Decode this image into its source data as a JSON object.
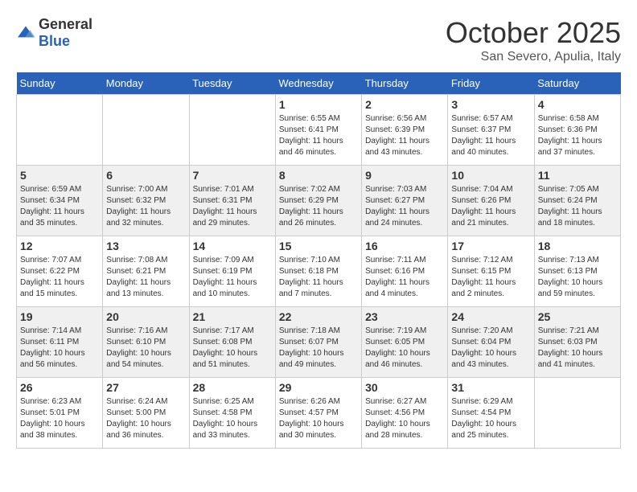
{
  "header": {
    "logo_general": "General",
    "logo_blue": "Blue",
    "month_title": "October 2025",
    "subtitle": "San Severo, Apulia, Italy"
  },
  "days_of_week": [
    "Sunday",
    "Monday",
    "Tuesday",
    "Wednesday",
    "Thursday",
    "Friday",
    "Saturday"
  ],
  "weeks": [
    {
      "days": [
        {
          "number": "",
          "info": ""
        },
        {
          "number": "",
          "info": ""
        },
        {
          "number": "",
          "info": ""
        },
        {
          "number": "1",
          "info": "Sunrise: 6:55 AM\nSunset: 6:41 PM\nDaylight: 11 hours and 46 minutes."
        },
        {
          "number": "2",
          "info": "Sunrise: 6:56 AM\nSunset: 6:39 PM\nDaylight: 11 hours and 43 minutes."
        },
        {
          "number": "3",
          "info": "Sunrise: 6:57 AM\nSunset: 6:37 PM\nDaylight: 11 hours and 40 minutes."
        },
        {
          "number": "4",
          "info": "Sunrise: 6:58 AM\nSunset: 6:36 PM\nDaylight: 11 hours and 37 minutes."
        }
      ],
      "shaded": false
    },
    {
      "days": [
        {
          "number": "5",
          "info": "Sunrise: 6:59 AM\nSunset: 6:34 PM\nDaylight: 11 hours and 35 minutes."
        },
        {
          "number": "6",
          "info": "Sunrise: 7:00 AM\nSunset: 6:32 PM\nDaylight: 11 hours and 32 minutes."
        },
        {
          "number": "7",
          "info": "Sunrise: 7:01 AM\nSunset: 6:31 PM\nDaylight: 11 hours and 29 minutes."
        },
        {
          "number": "8",
          "info": "Sunrise: 7:02 AM\nSunset: 6:29 PM\nDaylight: 11 hours and 26 minutes."
        },
        {
          "number": "9",
          "info": "Sunrise: 7:03 AM\nSunset: 6:27 PM\nDaylight: 11 hours and 24 minutes."
        },
        {
          "number": "10",
          "info": "Sunrise: 7:04 AM\nSunset: 6:26 PM\nDaylight: 11 hours and 21 minutes."
        },
        {
          "number": "11",
          "info": "Sunrise: 7:05 AM\nSunset: 6:24 PM\nDaylight: 11 hours and 18 minutes."
        }
      ],
      "shaded": true
    },
    {
      "days": [
        {
          "number": "12",
          "info": "Sunrise: 7:07 AM\nSunset: 6:22 PM\nDaylight: 11 hours and 15 minutes."
        },
        {
          "number": "13",
          "info": "Sunrise: 7:08 AM\nSunset: 6:21 PM\nDaylight: 11 hours and 13 minutes."
        },
        {
          "number": "14",
          "info": "Sunrise: 7:09 AM\nSunset: 6:19 PM\nDaylight: 11 hours and 10 minutes."
        },
        {
          "number": "15",
          "info": "Sunrise: 7:10 AM\nSunset: 6:18 PM\nDaylight: 11 hours and 7 minutes."
        },
        {
          "number": "16",
          "info": "Sunrise: 7:11 AM\nSunset: 6:16 PM\nDaylight: 11 hours and 4 minutes."
        },
        {
          "number": "17",
          "info": "Sunrise: 7:12 AM\nSunset: 6:15 PM\nDaylight: 11 hours and 2 minutes."
        },
        {
          "number": "18",
          "info": "Sunrise: 7:13 AM\nSunset: 6:13 PM\nDaylight: 10 hours and 59 minutes."
        }
      ],
      "shaded": false
    },
    {
      "days": [
        {
          "number": "19",
          "info": "Sunrise: 7:14 AM\nSunset: 6:11 PM\nDaylight: 10 hours and 56 minutes."
        },
        {
          "number": "20",
          "info": "Sunrise: 7:16 AM\nSunset: 6:10 PM\nDaylight: 10 hours and 54 minutes."
        },
        {
          "number": "21",
          "info": "Sunrise: 7:17 AM\nSunset: 6:08 PM\nDaylight: 10 hours and 51 minutes."
        },
        {
          "number": "22",
          "info": "Sunrise: 7:18 AM\nSunset: 6:07 PM\nDaylight: 10 hours and 49 minutes."
        },
        {
          "number": "23",
          "info": "Sunrise: 7:19 AM\nSunset: 6:05 PM\nDaylight: 10 hours and 46 minutes."
        },
        {
          "number": "24",
          "info": "Sunrise: 7:20 AM\nSunset: 6:04 PM\nDaylight: 10 hours and 43 minutes."
        },
        {
          "number": "25",
          "info": "Sunrise: 7:21 AM\nSunset: 6:03 PM\nDaylight: 10 hours and 41 minutes."
        }
      ],
      "shaded": true
    },
    {
      "days": [
        {
          "number": "26",
          "info": "Sunrise: 6:23 AM\nSunset: 5:01 PM\nDaylight: 10 hours and 38 minutes."
        },
        {
          "number": "27",
          "info": "Sunrise: 6:24 AM\nSunset: 5:00 PM\nDaylight: 10 hours and 36 minutes."
        },
        {
          "number": "28",
          "info": "Sunrise: 6:25 AM\nSunset: 4:58 PM\nDaylight: 10 hours and 33 minutes."
        },
        {
          "number": "29",
          "info": "Sunrise: 6:26 AM\nSunset: 4:57 PM\nDaylight: 10 hours and 30 minutes."
        },
        {
          "number": "30",
          "info": "Sunrise: 6:27 AM\nSunset: 4:56 PM\nDaylight: 10 hours and 28 minutes."
        },
        {
          "number": "31",
          "info": "Sunrise: 6:29 AM\nSunset: 4:54 PM\nDaylight: 10 hours and 25 minutes."
        },
        {
          "number": "",
          "info": ""
        }
      ],
      "shaded": false
    }
  ]
}
